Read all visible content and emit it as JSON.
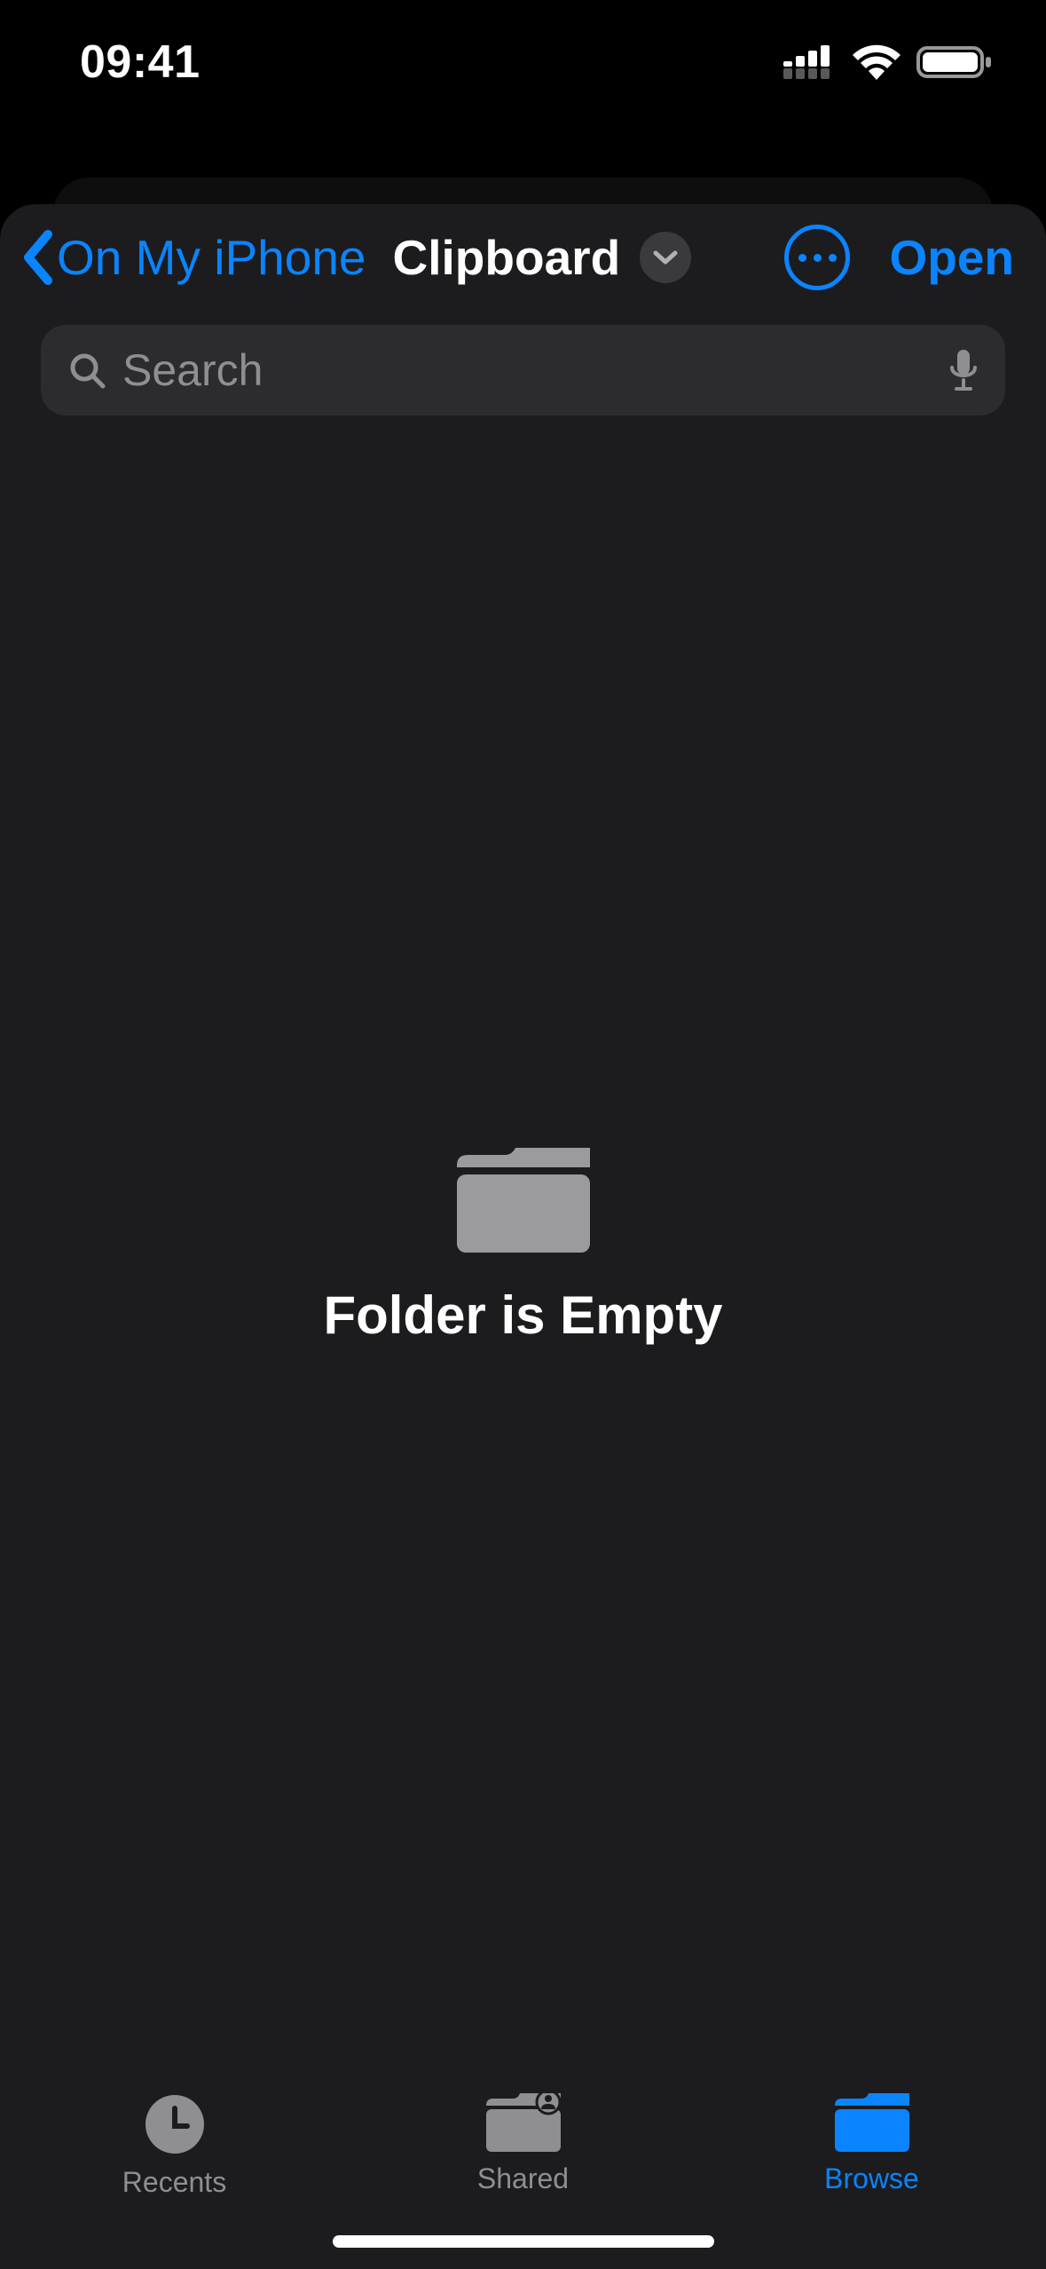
{
  "status": {
    "time": "09:41"
  },
  "nav": {
    "back_label": "On My iPhone",
    "title": "Clipboard",
    "open_label": "Open"
  },
  "search": {
    "placeholder": "Search"
  },
  "content": {
    "empty_message": "Folder is Empty"
  },
  "tabs": {
    "recents": "Recents",
    "shared": "Shared",
    "browse": "Browse"
  },
  "colors": {
    "accent": "#0A84FF"
  }
}
